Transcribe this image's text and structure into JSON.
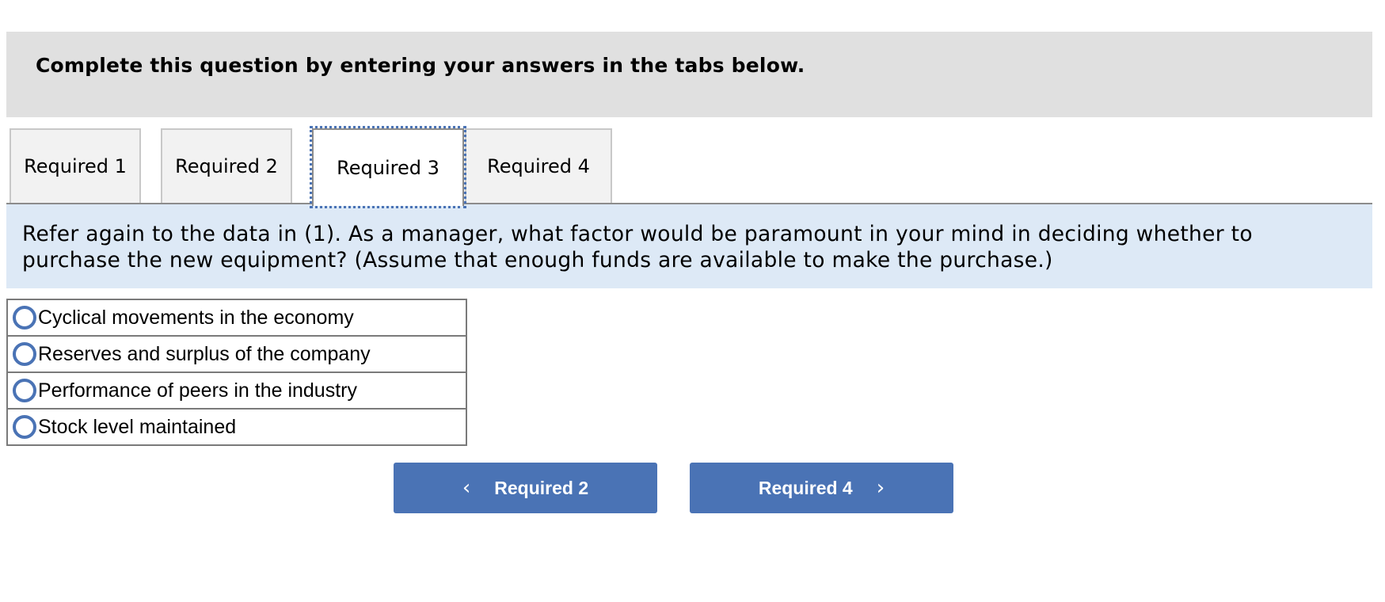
{
  "header": {
    "instruction": "Complete this question by entering your answers in the tabs below."
  },
  "tabs": [
    {
      "label": "Required 1",
      "active": false
    },
    {
      "label": "Required 2",
      "active": false
    },
    {
      "label": "Required 3",
      "active": true
    },
    {
      "label": "Required 4",
      "active": false
    }
  ],
  "question": {
    "text": "Refer again to the data in (1). As a manager, what factor would be paramount in your mind in deciding whether to purchase the new equipment? (Assume that enough funds are available to make the purchase.)"
  },
  "options": [
    {
      "label": "Cyclical movements in the economy",
      "selected": false
    },
    {
      "label": "Reserves and surplus of the company",
      "selected": false
    },
    {
      "label": "Performance of peers in the industry",
      "selected": false
    },
    {
      "label": "Stock level maintained",
      "selected": false
    }
  ],
  "navigation": {
    "prev_label": "Required 2",
    "prev_icon": "chevron-left-icon",
    "next_label": "Required 4",
    "next_icon": "chevron-right-icon"
  },
  "colors": {
    "accent": "#4a73b5",
    "header_bg": "#e0e0e0",
    "question_bg": "#dde9f6"
  }
}
